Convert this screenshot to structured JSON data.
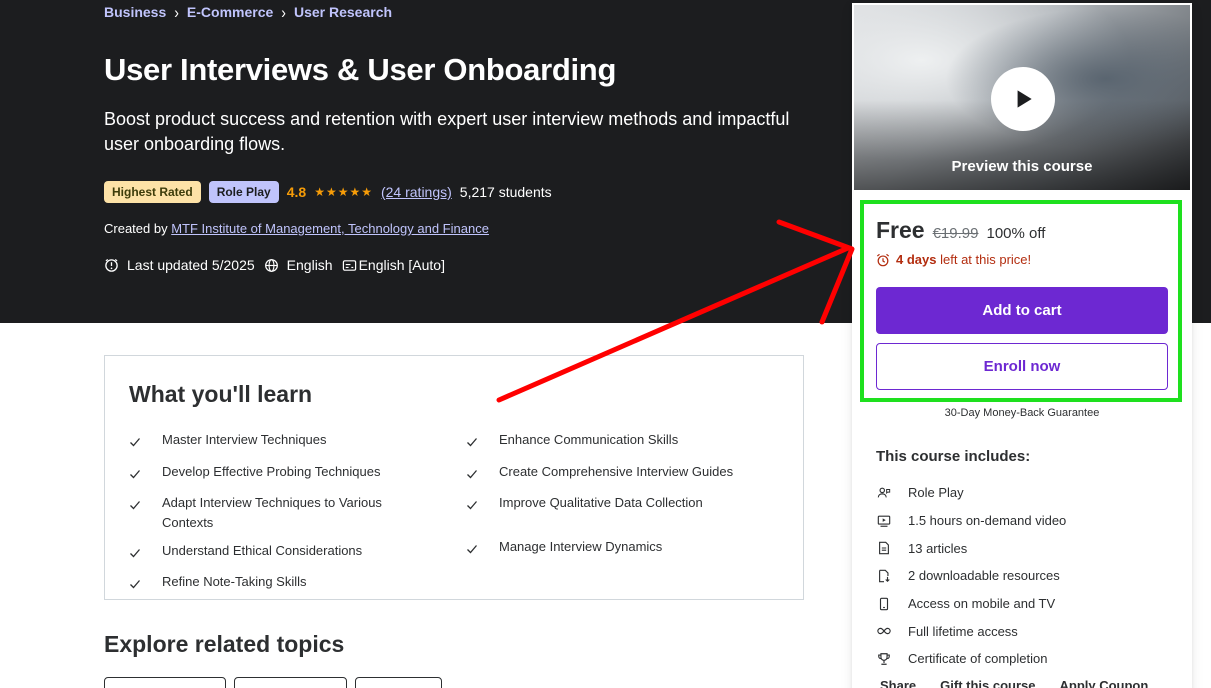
{
  "breadcrumb": [
    "Business",
    "E-Commerce",
    "User Research"
  ],
  "course": {
    "title": "User Interviews & User Onboarding",
    "subtitle": "Boost product success and retention with expert user interview methods and impactful user onboarding flows.",
    "badges": [
      "Highest Rated",
      "Role Play"
    ],
    "rating": "4.8",
    "stars_filled": 5,
    "ratings_count": "(24 ratings)",
    "students": "5,217 students",
    "created_by_label": "Created by",
    "instructor": "MTF Institute of Management, Technology and Finance",
    "last_updated": "Last updated 5/2025",
    "language": "English",
    "captions": "English [Auto]"
  },
  "sidebar": {
    "preview_label": "Preview this course",
    "price": "Free",
    "original_price": "€19.99",
    "discount": "100% off",
    "timer_bold": "4 days",
    "timer_rest": "left at this price!",
    "add_to_cart": "Add to cart",
    "enroll_now": "Enroll now",
    "guarantee": "30-Day Money-Back Guarantee",
    "includes_title": "This course includes:",
    "includes": [
      {
        "icon": "role-play-icon",
        "label": "Role Play"
      },
      {
        "icon": "video-icon",
        "label": "1.5 hours on-demand video"
      },
      {
        "icon": "article-icon",
        "label": "13 articles"
      },
      {
        "icon": "download-icon",
        "label": "2 downloadable resources"
      },
      {
        "icon": "mobile-icon",
        "label": "Access on mobile and TV"
      },
      {
        "icon": "infinity-icon",
        "label": "Full lifetime access"
      },
      {
        "icon": "trophy-icon",
        "label": "Certificate of completion"
      }
    ],
    "share_links": [
      "Share",
      "Gift this course",
      "Apply Coupon"
    ]
  },
  "learn": {
    "title": "What you'll learn",
    "col1": [
      "Master Interview Techniques",
      "Develop Effective Probing Techniques",
      "Adapt Interview Techniques to Various Contexts",
      "Understand Ethical Considerations",
      "Refine Note-Taking Skills"
    ],
    "col2": [
      "Enhance Communication Skills",
      "Create Comprehensive Interview Guides",
      "Improve Qualitative Data Collection",
      "Manage Interview Dynamics"
    ]
  },
  "explore": {
    "title": "Explore related topics"
  },
  "colors": {
    "hero_bg": "#1c1d1f",
    "accent": "#6d28d2",
    "link": "#c0c4fc",
    "rating": "#f69c08",
    "highlight_box": "#1ee01e",
    "annotation_arrow": "#ff0000"
  }
}
